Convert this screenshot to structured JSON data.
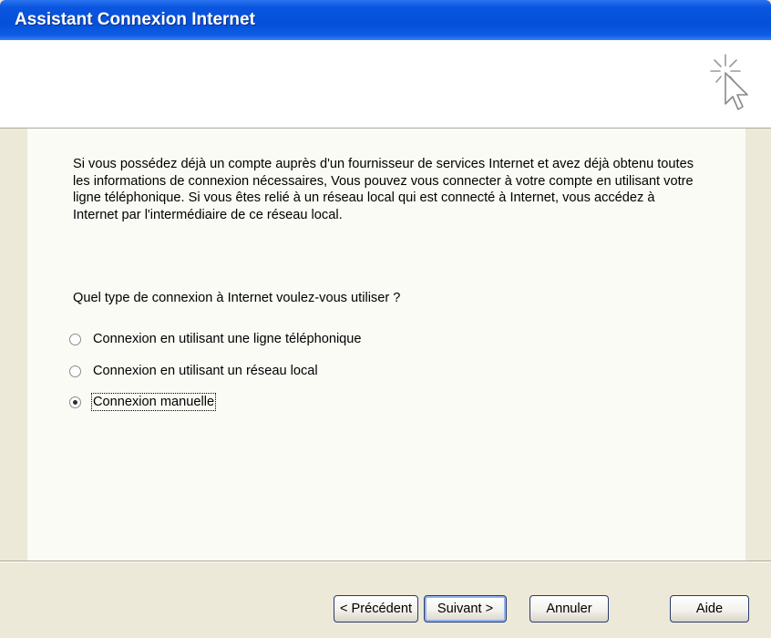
{
  "window": {
    "title": "Assistant Connexion Internet"
  },
  "header": {
    "icon": "wizard-cursor-icon"
  },
  "content": {
    "intro": "Si vous possédez déjà un compte auprès d'un fournisseur de services Internet et avez déjà obtenu toutes les informations de connexion nécessaires, Vous pouvez vous connecter à votre compte en utilisant votre ligne téléphonique. Si vous êtes relié à un réseau local qui est connecté à Internet, vous accédez à Internet par l'intermédiaire de ce réseau local.",
    "question": "Quel type de connexion à Internet voulez-vous utiliser ?",
    "options": [
      {
        "label": "Connexion en utilisant une ligne téléphonique",
        "selected": false
      },
      {
        "label": "Connexion en utilisant un réseau local",
        "selected": false
      },
      {
        "label": "Connexion manuelle",
        "selected": true
      }
    ]
  },
  "buttons": {
    "back": "< Précédent",
    "next": "Suivant >",
    "cancel": "Annuler",
    "help": "Aide"
  }
}
